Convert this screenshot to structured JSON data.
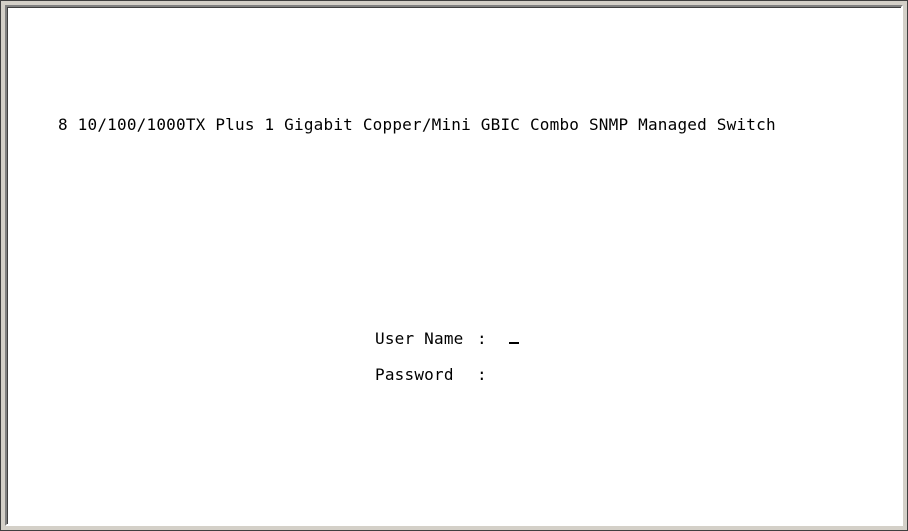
{
  "terminal": {
    "device_title": "8 10/100/1000TX Plus 1 Gigabit Copper/Mini GBIC Combo SNMP Managed Switch",
    "login": {
      "username_label": "User Name",
      "password_label": "Password",
      "separator": ":",
      "username_value": "",
      "password_value": ""
    }
  }
}
